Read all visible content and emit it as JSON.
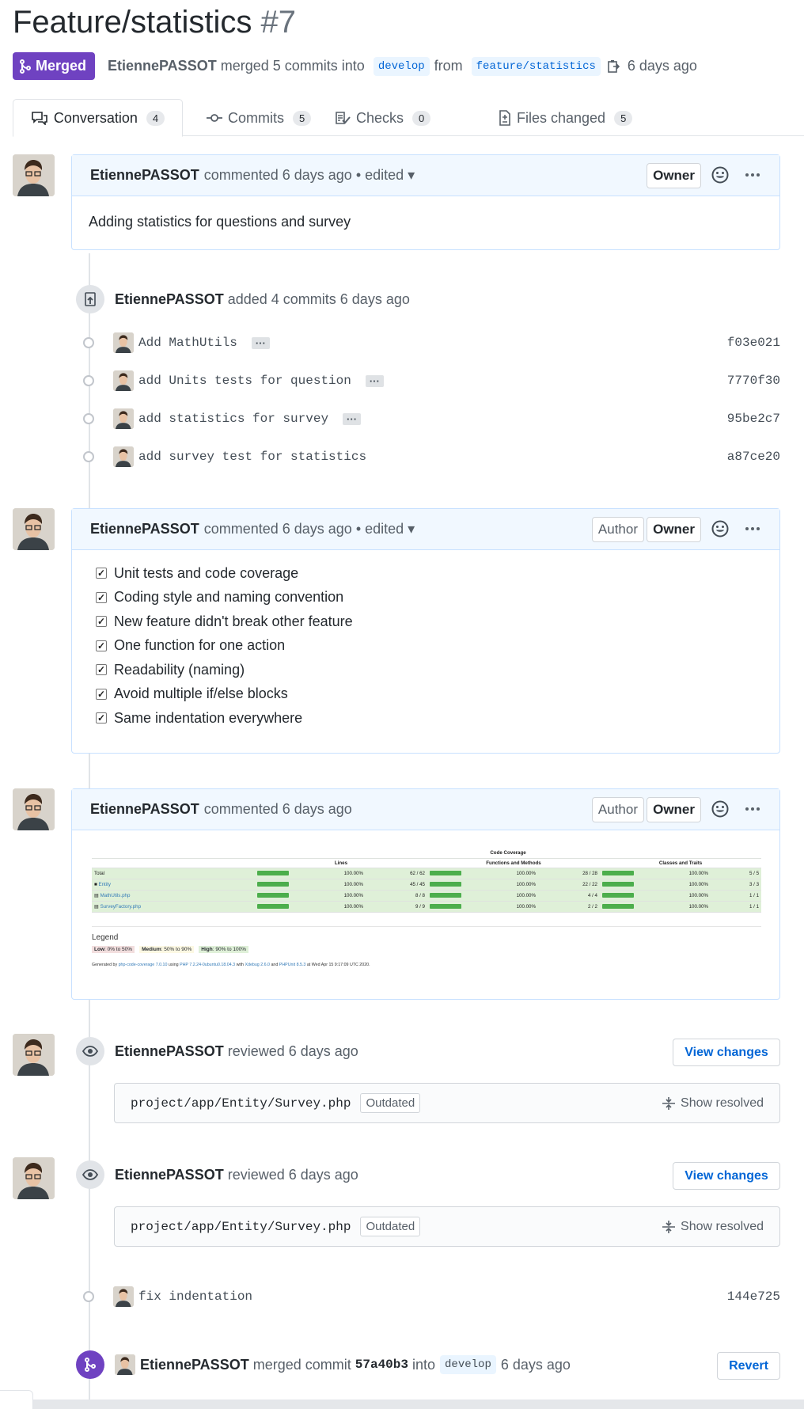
{
  "pr": {
    "title": "Feature/statistics",
    "number": "#7",
    "state": "Merged",
    "author": "EtiennePASSOT",
    "merge_text": "merged 5 commits into",
    "base_branch": "develop",
    "from_text": "from",
    "head_branch": "feature/statistics",
    "time": "6 days ago"
  },
  "tabs": [
    {
      "label": "Conversation",
      "count": "4",
      "icon": "comment-discussion-icon"
    },
    {
      "label": "Commits",
      "count": "5",
      "icon": "git-commit-icon"
    },
    {
      "label": "Checks",
      "count": "0",
      "icon": "checklist-icon"
    },
    {
      "label": "Files changed",
      "count": "5",
      "icon": "file-diff-icon"
    }
  ],
  "comment1": {
    "author": "EtiennePASSOT",
    "meta": "commented 6 days ago • edited ▾",
    "owner_label": "Owner",
    "body": "Adding statistics for questions and survey"
  },
  "commits_event": {
    "author": "EtiennePASSOT",
    "text": "added 4 commits 6 days ago",
    "commits": [
      {
        "message": "Add MathUtils",
        "sha": "f03e021",
        "ellipsis": "···"
      },
      {
        "message": "add Units tests for question",
        "sha": "7770f30",
        "ellipsis": "···"
      },
      {
        "message": "add statistics for survey",
        "sha": "95be2c7",
        "ellipsis": "···"
      },
      {
        "message": "add survey test for statistics",
        "sha": "a87ce20"
      }
    ]
  },
  "comment2": {
    "author": "EtiennePASSOT",
    "meta": "commented 6 days ago • edited ▾",
    "author_label": "Author",
    "owner_label": "Owner",
    "checklist": [
      "Unit tests and code coverage",
      "Coding style and naming convention",
      "New feature didn't break other feature",
      "One function for one action",
      "Readability (naming)",
      "Avoid multiple if/else blocks",
      "Same indentation everywhere"
    ]
  },
  "comment3": {
    "author": "EtiennePASSOT",
    "meta": "commented 6 days ago",
    "author_label": "Author",
    "owner_label": "Owner",
    "coverage": {
      "header": "Code Coverage",
      "columns": [
        "Lines",
        "Functions and Methods",
        "Classes and Traits"
      ],
      "rows": [
        {
          "name": "Total",
          "lines_pct": "100.00%",
          "lines": "62 / 62",
          "func_pct": "100.00%",
          "func": "28 / 28",
          "cls_pct": "100.00%",
          "cls": "5 / 5"
        },
        {
          "name": "Entity",
          "lines_pct": "100.00%",
          "lines": "45 / 45",
          "func_pct": "100.00%",
          "func": "22 / 22",
          "cls_pct": "100.00%",
          "cls": "3 / 3"
        },
        {
          "name": "MathUtils.php",
          "lines_pct": "100.00%",
          "lines": "8 / 8",
          "func_pct": "100.00%",
          "func": "4 / 4",
          "cls_pct": "100.00%",
          "cls": "1 / 1"
        },
        {
          "name": "SurveyFactory.php",
          "lines_pct": "100.00%",
          "lines": "9 / 9",
          "func_pct": "100.00%",
          "func": "2 / 2",
          "cls_pct": "100.00%",
          "cls": "1 / 1"
        }
      ],
      "legend_title": "Legend",
      "legend": [
        {
          "label": "Low",
          "range": ": 0% to 50%",
          "color": "#f2dede"
        },
        {
          "label": "Medium",
          "range": ": 50% to 90%",
          "color": "#fcf8e3"
        },
        {
          "label": "High",
          "range": ": 90% to 100%",
          "color": "#dff0d8"
        }
      ],
      "generated": {
        "prefix": "Generated by",
        "tool": "php-code-coverage 7.0.10",
        "using": "using",
        "php": "PHP 7.2.24-0ubuntu0.18.04.3",
        "with": "with",
        "xdebug": "Xdebug 2.6.0",
        "and": "and",
        "phpunit": "PHPUnit 8.5.3",
        "suffix": "at Wed Apr 15 9:17:09 UTC 2020."
      }
    }
  },
  "review1": {
    "author": "EtiennePASSOT",
    "text": "reviewed 6 days ago",
    "button": "View changes",
    "file": "project/app/Entity/Survey.php",
    "outdated": "Outdated",
    "resolved": "Show resolved"
  },
  "review2": {
    "author": "EtiennePASSOT",
    "text": "reviewed 6 days ago",
    "button": "View changes",
    "file": "project/app/Entity/Survey.php",
    "outdated": "Outdated",
    "resolved": "Show resolved"
  },
  "fix_commit": {
    "message": "fix indentation",
    "sha": "144e725"
  },
  "merge_event": {
    "author": "EtiennePASSOT",
    "text": "merged commit",
    "sha": "57a40b3",
    "into": "into",
    "branch": "develop",
    "time": "6 days ago",
    "button": "Revert"
  },
  "colors": {
    "merged": "#6f42c1",
    "link": "#0366d6",
    "header_bg": "#f1f8ff"
  }
}
